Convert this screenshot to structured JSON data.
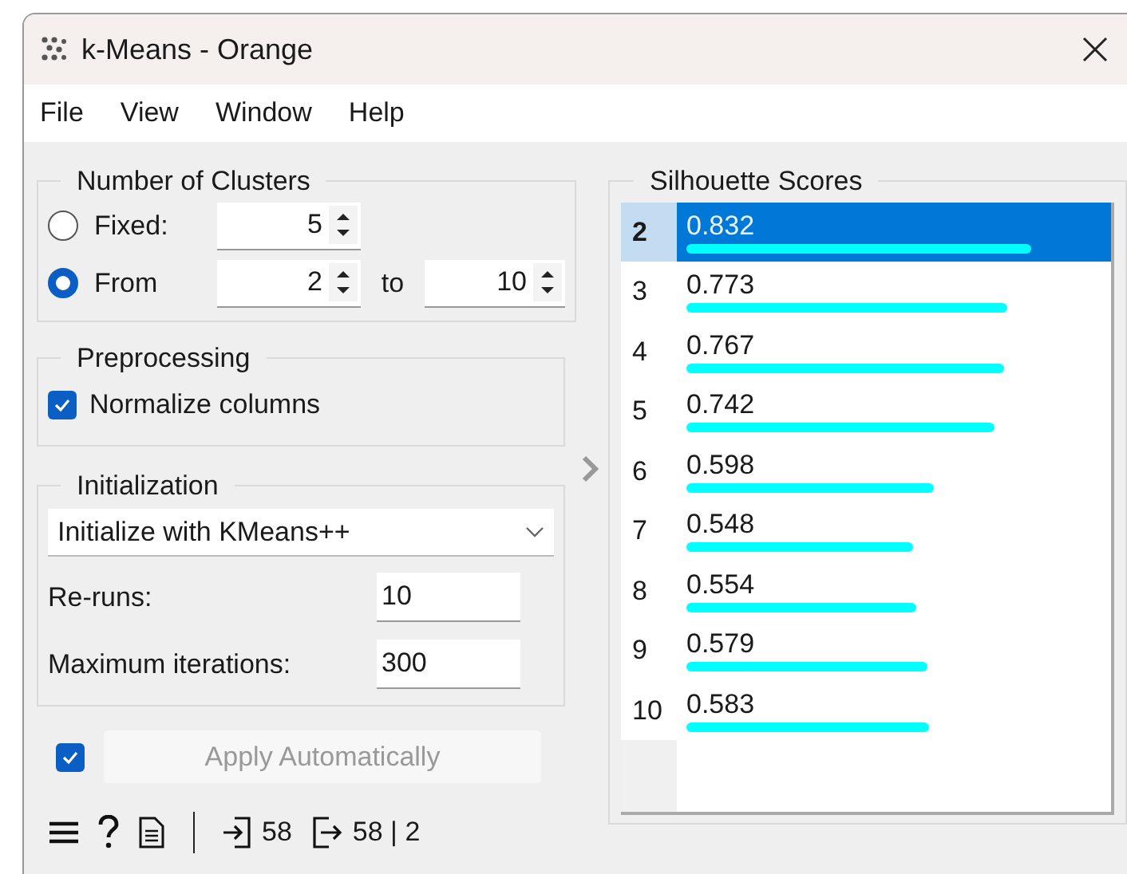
{
  "window": {
    "title": "k-Means - Orange"
  },
  "menu": [
    "File",
    "View",
    "Window",
    "Help"
  ],
  "number_of_clusters": {
    "title": "Number of Clusters",
    "options": [
      {
        "label": "Fixed:",
        "selected": false,
        "value": "5"
      },
      {
        "label": "From",
        "selected": true,
        "value": "2",
        "to_label": "to",
        "to_value": "10"
      }
    ]
  },
  "preprocessing": {
    "title": "Preprocessing",
    "normalize": {
      "label": "Normalize columns",
      "checked": true
    }
  },
  "initialization": {
    "title": "Initialization",
    "method": "Initialize with KMeans++",
    "reruns": {
      "label": "Re-runs:",
      "value": "10"
    },
    "max_iterations": {
      "label": "Maximum iterations:",
      "value": "300"
    }
  },
  "apply": {
    "label": "Apply Automatically",
    "checked": true,
    "disabled": true
  },
  "silhouette": {
    "title": "Silhouette Scores",
    "rows": [
      {
        "k": "2",
        "score": "0.832",
        "level": 0.832,
        "selected": true
      },
      {
        "k": "3",
        "score": "0.773",
        "level": 0.773,
        "selected": false
      },
      {
        "k": "4",
        "score": "0.767",
        "level": 0.767,
        "selected": false
      },
      {
        "k": "5",
        "score": "0.742",
        "level": 0.742,
        "selected": false
      },
      {
        "k": "6",
        "score": "0.598",
        "level": 0.598,
        "selected": false
      },
      {
        "k": "7",
        "score": "0.548",
        "level": 0.548,
        "selected": false
      },
      {
        "k": "8",
        "score": "0.554",
        "level": 0.554,
        "selected": false
      },
      {
        "k": "9",
        "score": "0.579",
        "level": 0.579,
        "selected": false
      },
      {
        "k": "10",
        "score": "0.583",
        "level": 0.583,
        "selected": false
      }
    ]
  },
  "status_bar": {
    "input_count": "58",
    "output_count": "58 | 2"
  }
}
